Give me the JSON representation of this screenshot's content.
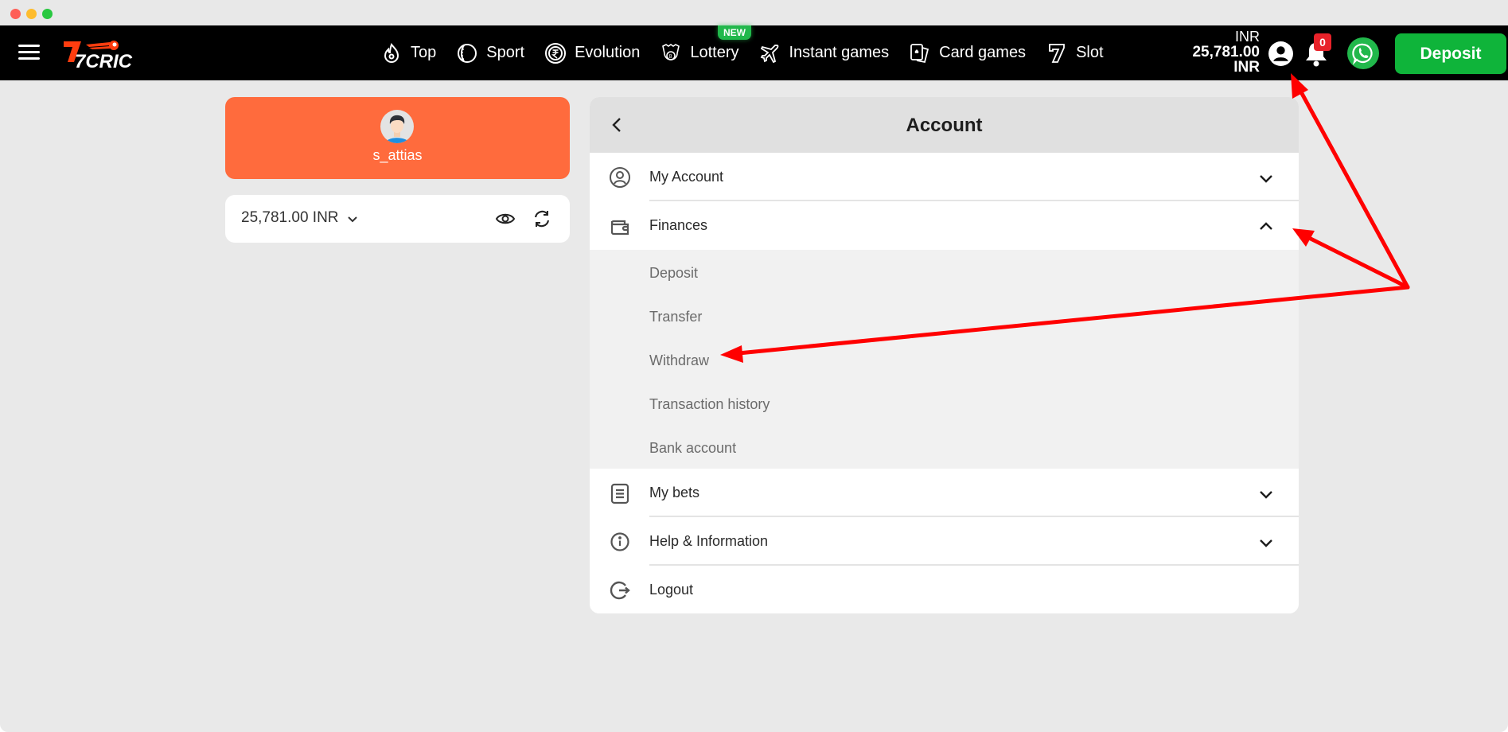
{
  "window": {
    "traffic_lights": [
      "close",
      "minimize",
      "maximize"
    ]
  },
  "navbar": {
    "menu_icon": "hamburger-icon",
    "logo_text": "7CRIC",
    "items": [
      {
        "label": "Top",
        "icon": "flame-icon"
      },
      {
        "label": "Sport",
        "icon": "cricket-ball-icon"
      },
      {
        "label": "Evolution",
        "icon": "rupee-chip-icon"
      },
      {
        "label": "Lottery",
        "icon": "lottery-ball-icon",
        "badge": "NEW"
      },
      {
        "label": "Instant games",
        "icon": "airplane-icon"
      },
      {
        "label": "Card games",
        "icon": "playing-cards-icon"
      },
      {
        "label": "Slot",
        "icon": "seven-icon"
      }
    ],
    "balance": {
      "currency_top": "INR",
      "amount": "25,781.00",
      "currency_bottom": "INR"
    },
    "notifications_count": "0",
    "deposit_label": "Deposit",
    "colors": {
      "background": "#000000",
      "deposit": "#0fb43a",
      "new_badge": "#21b84b",
      "notification_badge": "#e8222a"
    }
  },
  "profile": {
    "username": "s_attias",
    "card_color": "#ff6b3d"
  },
  "balance_card": {
    "amount": "25,781.00 INR"
  },
  "account_panel": {
    "title": "Account",
    "rows": [
      {
        "label": "My Account",
        "icon": "user-circle-icon",
        "expanded": false
      },
      {
        "label": "Finances",
        "icon": "wallet-icon",
        "expanded": true,
        "subitems": [
          "Deposit",
          "Transfer",
          "Withdraw",
          "Transaction history",
          "Bank account"
        ]
      },
      {
        "label": "My bets",
        "icon": "document-list-icon",
        "expanded": false
      },
      {
        "label": "Help & Information",
        "icon": "info-icon",
        "expanded": false
      },
      {
        "label": "Logout",
        "icon": "logout-icon"
      }
    ]
  },
  "annotations": {
    "color": "#ff0000",
    "arrows": [
      "to-user-icon",
      "to-finances-chevron",
      "to-withdraw"
    ]
  }
}
